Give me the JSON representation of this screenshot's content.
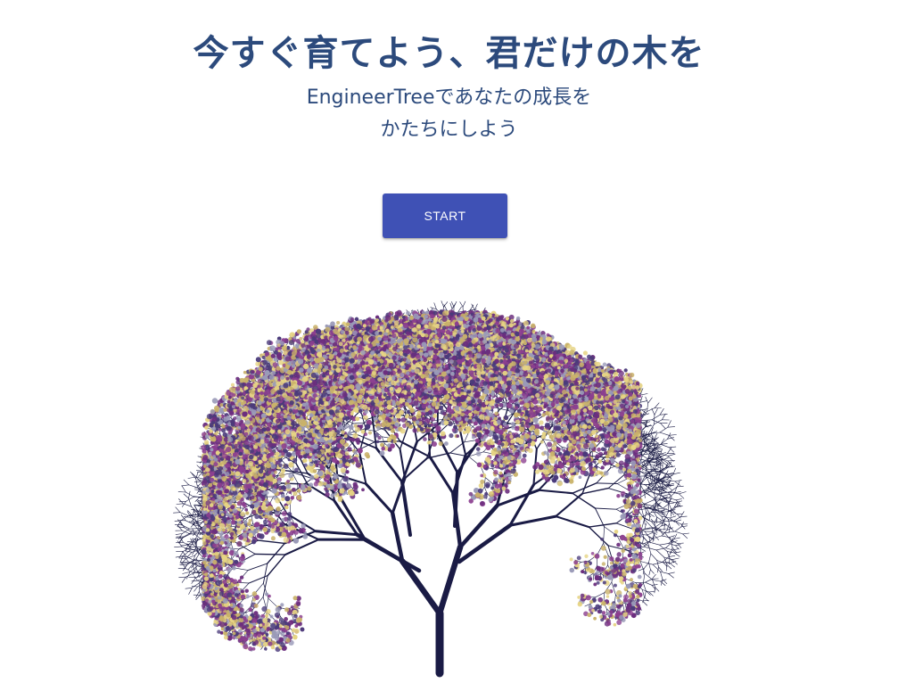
{
  "hero": {
    "title": "今すぐ育てよう、君だけの木を",
    "subtitle_line1": "EngineerTreeであなたの成長を",
    "subtitle_line2": "かたちにしよう",
    "start_button_label": "START"
  },
  "colors": {
    "heading_text": "#2c4a7c",
    "button_background": "#3f51b5",
    "button_text": "#ffffff",
    "tree_trunk": "#1a1b45",
    "blossom_palette": [
      "#6b2e7e",
      "#8b3f8f",
      "#e6d484",
      "#9a9ab8",
      "#4a3a7a",
      "#c9b26a"
    ]
  },
  "illustration": {
    "icon": "fractal-tree-icon"
  }
}
